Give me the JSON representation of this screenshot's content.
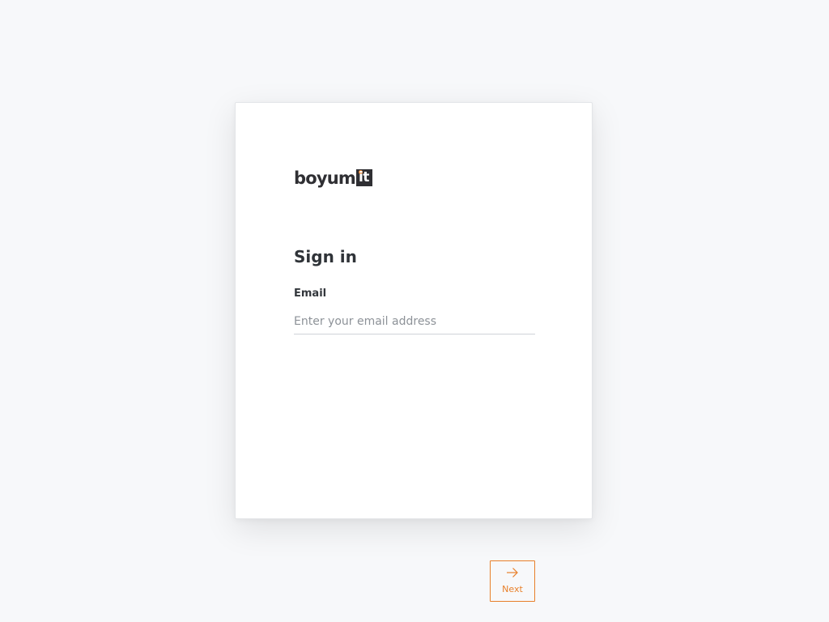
{
  "brand": {
    "name_part1": "boyum",
    "name_part2": "it",
    "accent_color": "#e8802a",
    "dark_color": "#2f2f33"
  },
  "signin": {
    "title": "Sign in",
    "email_label": "Email",
    "email_placeholder": "Enter your email address",
    "email_value": ""
  },
  "actions": {
    "next_label": "Next",
    "next_icon": "arrow-right-icon"
  }
}
